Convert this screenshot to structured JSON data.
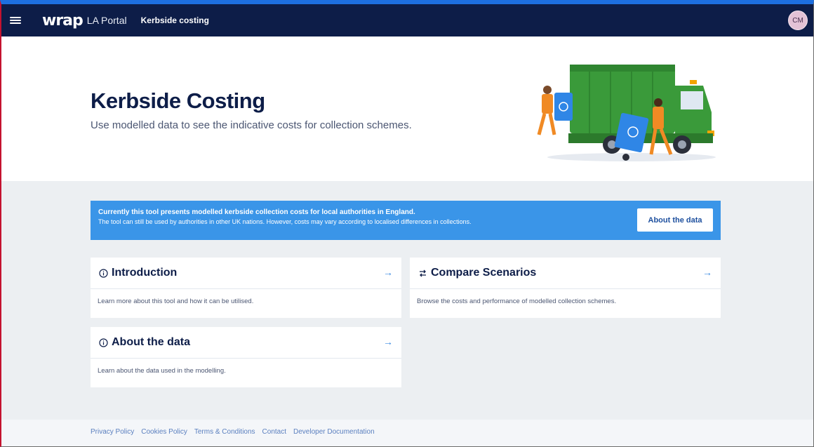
{
  "topbar": {
    "menu_icon": "hamburger-icon",
    "logo_text": "wrap",
    "portal_label": "LA Portal",
    "breadcrumb": "Kerbside costing",
    "avatar_initials": "CM"
  },
  "hero": {
    "title": "Kerbside Costing",
    "subtitle": "Use modelled data to see the indicative costs for collection schemes.",
    "illustration": "refuse-truck-illustration"
  },
  "banner": {
    "heading": "Currently this tool presents modelled kerbside collection costs for local authorities in England.",
    "text": "The tool can still be used by authorities in other UK nations. However, costs may vary according to localised differences in collections.",
    "button_label": "About the data"
  },
  "cards": [
    {
      "icon": "info-icon",
      "title": "Introduction",
      "description": "Learn more about this tool and how it can be utilised.",
      "arrow": "→"
    },
    {
      "icon": "swap-arrows-icon",
      "title": "Compare Scenarios",
      "description": "Browse the costs and performance of modelled collection schemes.",
      "arrow": "→"
    },
    {
      "icon": "info-icon",
      "title": "About the data",
      "description": "Learn about the data used in the modelling.",
      "arrow": "→"
    }
  ],
  "footer": {
    "links": [
      "Privacy Policy",
      "Cookies Policy",
      "Terms & Conditions",
      "Contact",
      "Developer Documentation"
    ]
  },
  "colors": {
    "navy": "#0d1d48",
    "banner_blue": "#3a95e8",
    "link_blue": "#3a8ae0",
    "content_bg": "#eceff2",
    "truck_green": "#3a9a3a"
  }
}
